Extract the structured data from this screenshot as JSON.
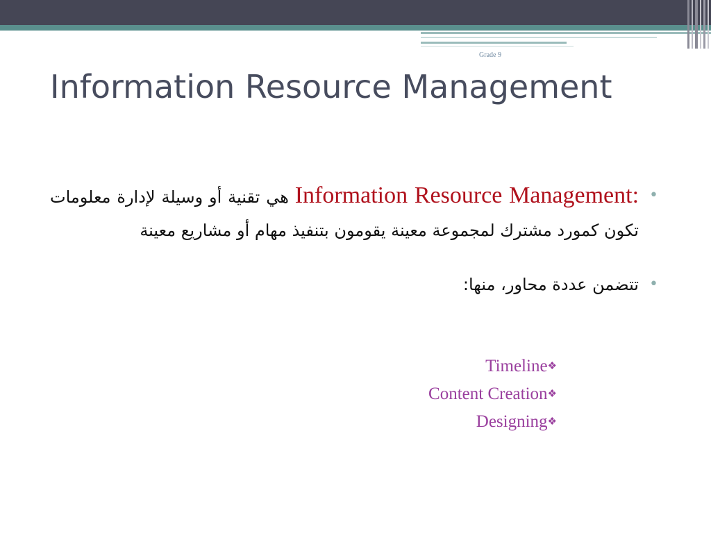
{
  "slide": {
    "grade": "Grade 9",
    "title": "Information Resource Management"
  },
  "bullets": [
    {
      "term": "Information Resource Management",
      "colon": ":",
      "text": "هي تقنية أو وسيلة لإدارة معلومات تكون كمورد مشترك لمجموعة معينة يقومون بتنفيذ مهام أو مشاريع معينة"
    },
    {
      "text": "تتضمن عددة محاور، منها",
      "colon": ":"
    }
  ],
  "subitems": [
    "Timeline",
    "Content Creation",
    "Designing"
  ],
  "icons": {
    "bullet": "bullet-dot-icon",
    "subitem": "diamond-bullet-icon"
  },
  "colors": {
    "top_band": "#454655",
    "teal_band": "#5a8f8d",
    "title": "#474c5e",
    "term": "#b0121d",
    "subitem": "#9a3f9e",
    "bullet_dot": "#8fb0ae"
  }
}
